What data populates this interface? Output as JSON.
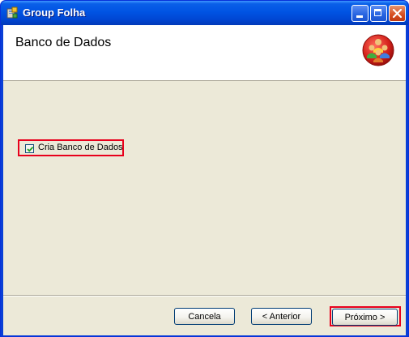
{
  "window": {
    "title": "Group Folha",
    "colors": {
      "titlebar": "#0054e3",
      "frame": "#ece9d8",
      "highlight": "#e8001c"
    },
    "controls": [
      "minimize-icon",
      "maximize-icon",
      "close-icon"
    ]
  },
  "header": {
    "title": "Banco de Dados",
    "logo": "group-people-logo"
  },
  "options": {
    "create_db": {
      "label": "Cria Banco de Dados",
      "checked": true
    }
  },
  "footer": {
    "cancel_label": "Cancela",
    "back_label": "< Anterior",
    "next_label": "Próximo >"
  }
}
